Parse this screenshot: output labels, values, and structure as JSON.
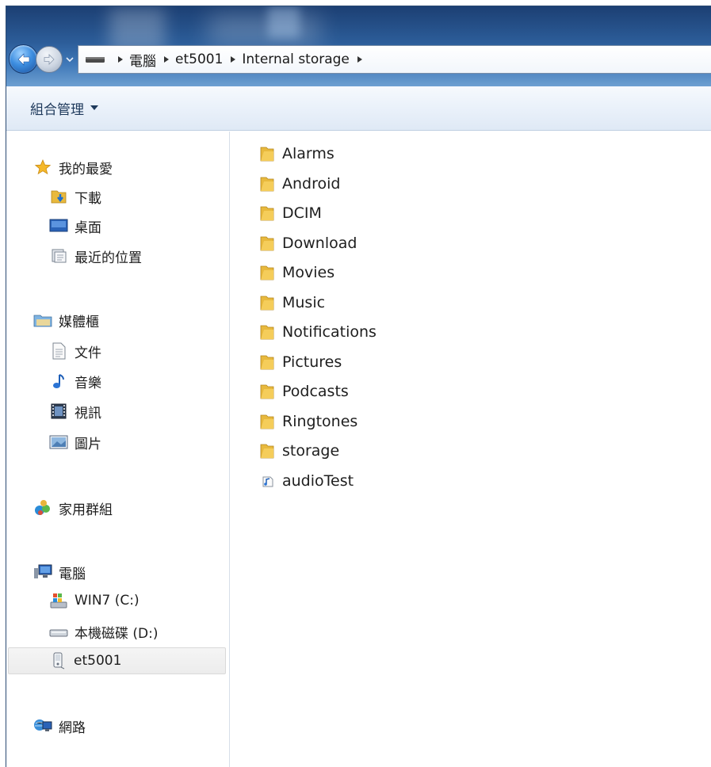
{
  "address_bar": {
    "drive_icon": "removable-device-icon",
    "crumbs": [
      "電腦",
      "et5001",
      "Internal storage"
    ]
  },
  "toolbar": {
    "organize_label": "組合管理"
  },
  "nav": {
    "favorites": {
      "label": "我的最愛",
      "items": [
        {
          "label": "下載",
          "icon": "downloads-icon"
        },
        {
          "label": "桌面",
          "icon": "desktop-icon"
        },
        {
          "label": "最近的位置",
          "icon": "recent-places-icon"
        }
      ]
    },
    "libraries": {
      "label": "媒體櫃",
      "items": [
        {
          "label": "文件",
          "icon": "document-icon"
        },
        {
          "label": "音樂",
          "icon": "music-icon"
        },
        {
          "label": "視訊",
          "icon": "video-icon"
        },
        {
          "label": "圖片",
          "icon": "picture-icon"
        }
      ]
    },
    "homegroup": {
      "label": "家用群組"
    },
    "computer": {
      "label": "電腦",
      "items": [
        {
          "label": "WIN7 (C:)",
          "icon": "windows-drive-icon"
        },
        {
          "label": "本機磁碟 (D:)",
          "icon": "hard-drive-icon"
        },
        {
          "label": "et5001",
          "icon": "portable-device-icon"
        }
      ]
    },
    "network": {
      "label": "網路"
    }
  },
  "files": [
    {
      "name": "Alarms",
      "type": "folder"
    },
    {
      "name": "Android",
      "type": "folder"
    },
    {
      "name": "DCIM",
      "type": "folder"
    },
    {
      "name": "Download",
      "type": "folder"
    },
    {
      "name": "Movies",
      "type": "folder"
    },
    {
      "name": "Music",
      "type": "folder"
    },
    {
      "name": "Notifications",
      "type": "folder"
    },
    {
      "name": "Pictures",
      "type": "folder"
    },
    {
      "name": "Podcasts",
      "type": "folder"
    },
    {
      "name": "Ringtones",
      "type": "folder"
    },
    {
      "name": "storage",
      "type": "folder"
    },
    {
      "name": "audioTest",
      "type": "audio-file"
    }
  ],
  "colors": {
    "titlebar": "#2c5d99",
    "commandbar": "#eaf1fa",
    "folder": "#e8b93d",
    "link_text": "#1e395b"
  }
}
